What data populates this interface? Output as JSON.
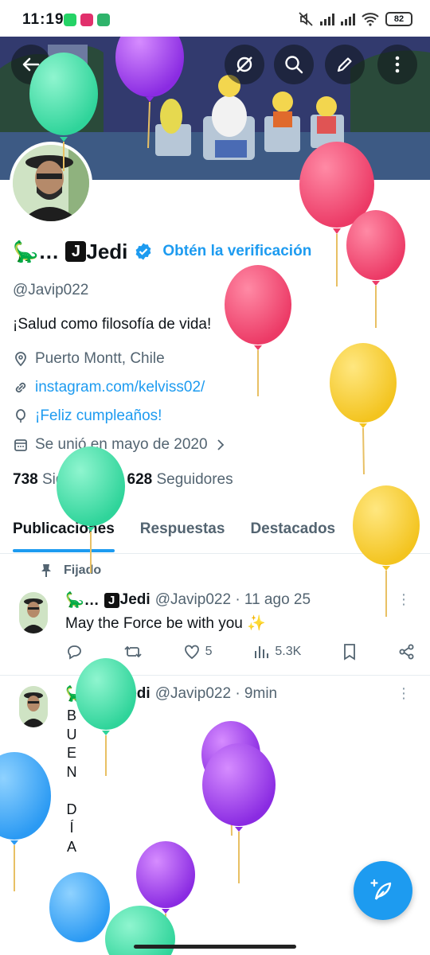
{
  "status_bar": {
    "time": "11:19",
    "battery": "82"
  },
  "profile": {
    "display_name": "Jedi",
    "display_name_prefix": "🦕…",
    "verify_link": "Obtén la verificación",
    "handle": "@Javip022",
    "bio": "¡Salud como filosofía de vida!",
    "location": "Puerto Montt, Chile",
    "website": "instagram.com/kelviss02/",
    "birthday": "¡Feliz cumpleaños!",
    "joined": "Se unió en mayo de 2020",
    "following_count": "738",
    "following_label": "Siguiendo",
    "followers_count": "628",
    "followers_label": "Seguidores"
  },
  "tabs": [
    {
      "label": "Publicaciones",
      "active": true
    },
    {
      "label": "Respuestas",
      "active": false
    },
    {
      "label": "Destacados",
      "active": false
    },
    {
      "label": "Artí",
      "active": false
    }
  ],
  "pinned_label": "Fijado",
  "posts": [
    {
      "name": "Jedi",
      "handle_time": "@Javip022 · 11 ago 25",
      "text": "May the Force be with you ✨",
      "likes": "5",
      "views": "5.3K"
    },
    {
      "name": "Jedi",
      "handle_time": "@Javip022 · 9min",
      "vertical_text": [
        "B",
        "U",
        "E",
        "N",
        "",
        "D",
        "Í",
        "A"
      ]
    }
  ],
  "colors": {
    "accent": "#1d9bf0",
    "text": "#0f1419",
    "muted": "#536471"
  }
}
